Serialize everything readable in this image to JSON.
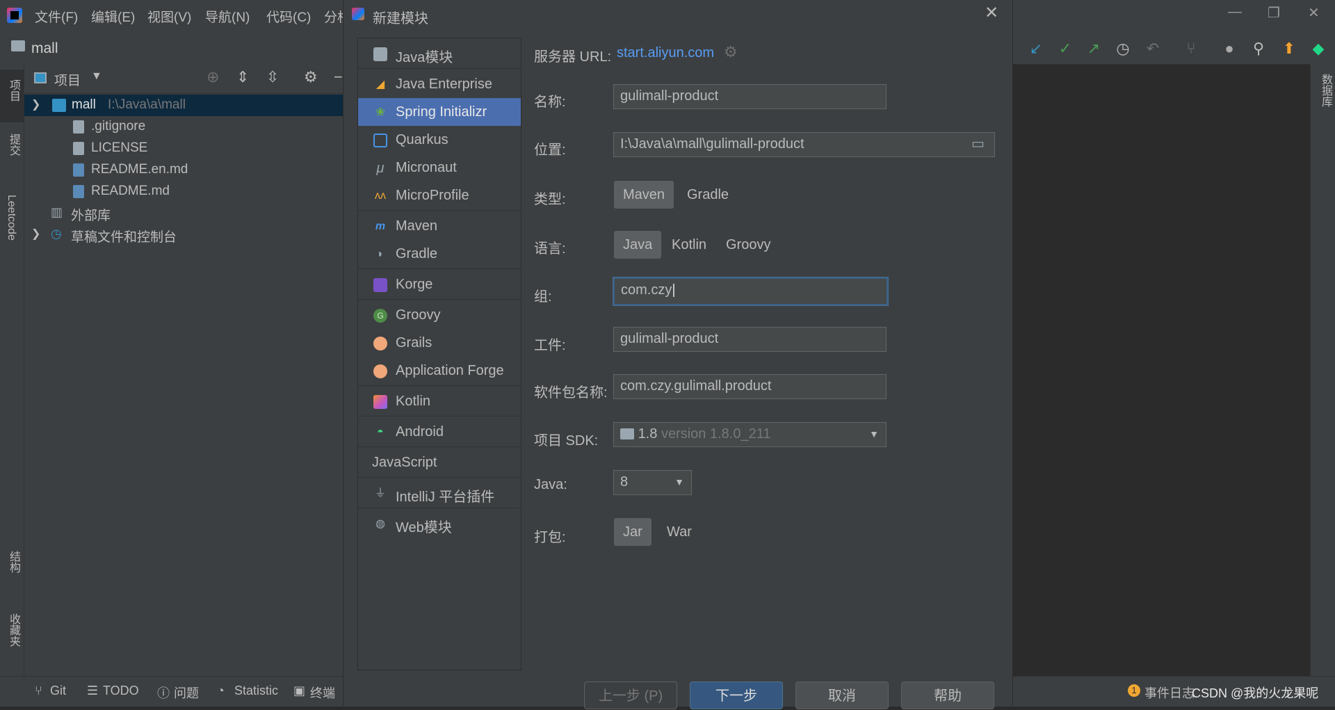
{
  "menubar": {
    "items": [
      "文件(F)",
      "编辑(E)",
      "视图(V)",
      "导航(N)",
      "代码(C)",
      "分析"
    ],
    "window_controls": [
      "—",
      "❐",
      "✕"
    ]
  },
  "navbar": {
    "project": "mall"
  },
  "left_strip": {
    "project": "项目",
    "commit": "提交",
    "leetcode": "Leetcode",
    "structure": "结构",
    "favorites": "收藏夹"
  },
  "right_strip": {
    "database": "数据库"
  },
  "project_panel": {
    "header": "项目",
    "tree": [
      {
        "name": "mall",
        "path": "I:\\Java\\a\\mall"
      },
      {
        "name": ".gitignore"
      },
      {
        "name": "LICENSE"
      },
      {
        "name": "README.en.md"
      },
      {
        "name": "README.md"
      },
      {
        "name": "外部库"
      },
      {
        "name": "草稿文件和控制台"
      }
    ]
  },
  "bottombar": {
    "items": [
      "Git",
      "TODO",
      "问题",
      "Statistic",
      "终端"
    ],
    "event_log": "事件日志",
    "event_count": "1",
    "watermark": "CSDN @我的火龙果呢"
  },
  "dialog": {
    "title": "新建模块",
    "modules": [
      "Java模块",
      "Java Enterprise",
      "Spring Initializr",
      "Quarkus",
      "Micronaut",
      "MicroProfile",
      "Maven",
      "Gradle",
      "Korge",
      "Groovy",
      "Grails",
      "Application Forge",
      "Kotlin",
      "Android",
      "JavaScript",
      "IntelliJ 平台插件",
      "Web模块"
    ],
    "selected_module": "Spring Initializr",
    "form": {
      "server_url_label": "服务器 URL:",
      "server_url": "start.aliyun.com",
      "name_label": "名称:",
      "name_value": "gulimall-product",
      "location_label": "位置:",
      "location_value": "I:\\Java\\a\\mall\\gulimall-product",
      "type_label": "类型:",
      "type_options": [
        "Maven",
        "Gradle"
      ],
      "type_selected": "Maven",
      "language_label": "语言:",
      "language_options": [
        "Java",
        "Kotlin",
        "Groovy"
      ],
      "language_selected": "Java",
      "group_label": "组:",
      "group_value": "com.czy",
      "artifact_label": "工件:",
      "artifact_value": "gulimall-product",
      "package_label": "软件包名称:",
      "package_value": "com.czy.gulimall.product",
      "sdk_label": "项目 SDK:",
      "sdk_value": "1.8",
      "sdk_version": "version 1.8.0_211",
      "java_label": "Java:",
      "java_value": "8",
      "packaging_label": "打包:",
      "packaging_options": [
        "Jar",
        "War"
      ],
      "packaging_selected": "Jar"
    },
    "buttons": {
      "prev": "上一步 (P)",
      "next": "下一步",
      "cancel": "取消",
      "help": "帮助"
    }
  }
}
